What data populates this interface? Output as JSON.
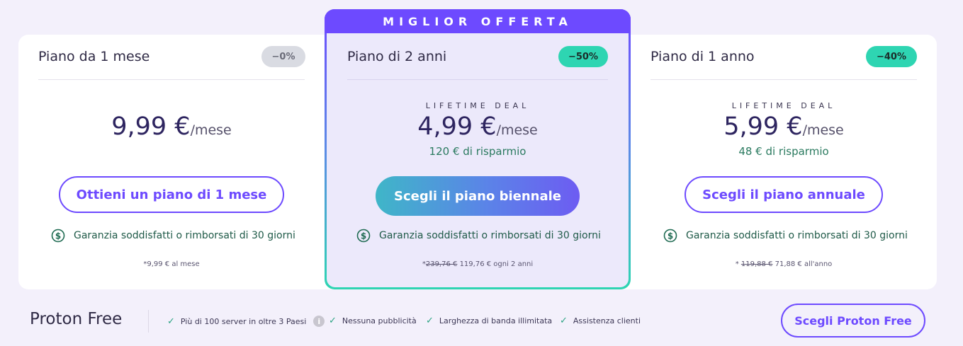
{
  "plans": [
    {
      "title": "Piano da 1 mese",
      "badge": "−0%",
      "deal_label": "",
      "price": "9,99 €",
      "unit": "/mese",
      "savings": "",
      "button": "Ottieni un piano di 1 mese",
      "guarantee": "Garanzia soddisfatti o rimborsati di 30 giorni",
      "footnote": "*9,99 € al mese"
    },
    {
      "banner": "MIGLIOR OFFERTA",
      "title": "Piano di 2 anni",
      "badge": "−50%",
      "deal_label": "LIFETIME DEAL",
      "price": "4,99 €",
      "unit": "/mese",
      "savings": "120 € di risparmio",
      "button": "Scegli il piano biennale",
      "guarantee": "Garanzia soddisfatti o rimborsati di 30 giorni",
      "footnote_prefix": "*",
      "footnote_old": "239,76 €",
      "footnote_rest": "119,76 € ogni 2 anni"
    },
    {
      "title": "Piano di 1 anno",
      "badge": "−40%",
      "deal_label": "LIFETIME DEAL",
      "price": "5,99 €",
      "unit": "/mese",
      "savings": "48 € di risparmio",
      "button": "Scegli il piano annuale",
      "guarantee": "Garanzia soddisfatti o rimborsati di 30 giorni",
      "footnote_prefix": "* ",
      "footnote_old": "119,88 €",
      "footnote_rest": "71,88 € all'anno"
    }
  ],
  "free": {
    "title": "Proton Free",
    "features": [
      "Più di 100 server in oltre 3 Paesi",
      "Nessuna pubblicità",
      "Larghezza di banda illimitata",
      "Assistenza clienti"
    ],
    "button": "Scegli Proton Free"
  },
  "colors": {
    "accent": "#6d4aff",
    "badge_green": "#2ed5b2",
    "badge_gray": "#d9dbe2",
    "savings_text": "#2a7a5f"
  },
  "icons": [
    "dollar-circle-icon",
    "check-icon",
    "info-icon"
  ]
}
